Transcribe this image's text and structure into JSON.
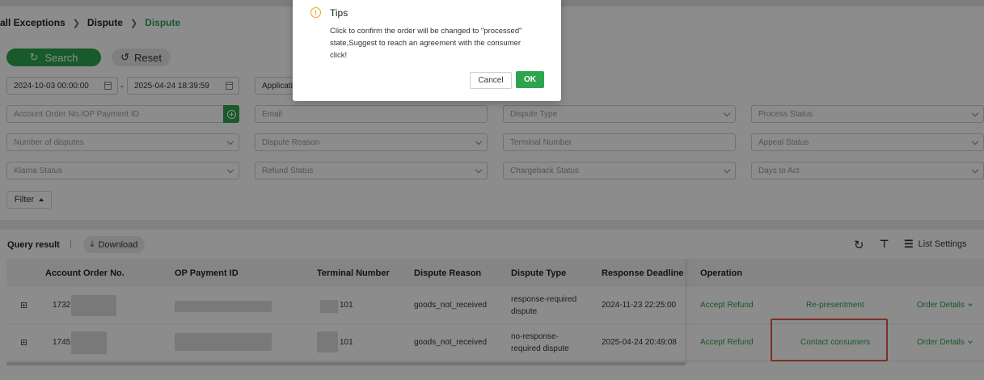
{
  "breadcrumb": [
    "all Exceptions",
    "Dispute",
    "Dispute"
  ],
  "buttons": {
    "search": "Search",
    "reset": "Reset",
    "filter": "Filter",
    "download": "Download",
    "list_settings": "List Settings"
  },
  "date_range": {
    "start": "2024-10-03 00:00:00",
    "separator": "-",
    "end": "2025-04-24 18:39:59"
  },
  "date_type_select": "Applicati",
  "fields": {
    "account_order": "Account Order No./OP Payment ID",
    "email": "Email",
    "dispute_type": "Dispute Type",
    "process_status": "Process Status",
    "number_of_disputes": "Number of disputes",
    "dispute_reason": "Dispute Reason",
    "terminal_number": "Terminal Number",
    "appeal_status": "Appeal Status",
    "klarna_status": "Klarna Status",
    "refund_status": "Refund Status",
    "chargeback_status": "Chargeback Status",
    "days_to_act": "Days to Act"
  },
  "query_result": {
    "label": "Query result",
    "separator": "|"
  },
  "table": {
    "headers": [
      "Account Order No.",
      "OP Payment ID",
      "Terminal Number",
      "Dispute Reason",
      "Dispute Type",
      "Response Deadline",
      "Operation"
    ],
    "rows": [
      {
        "order_prefix": "1732",
        "terminal_suffix": "101",
        "reason": "goods_not_received",
        "type_line1": "response-required",
        "type_line2": "dispute",
        "deadline": "2024-11-23 22:25:00",
        "op1": "Accept Refund",
        "op2": "Re-presentment",
        "op3": "Order Details"
      },
      {
        "order_prefix": "1745",
        "terminal_suffix": "101",
        "reason": "goods_not_received",
        "type_line1": "no-response-",
        "type_line2": "required dispute",
        "deadline": "2025-04-24 20:49:08",
        "op1": "Accept Refund",
        "op2": "Contact consumers",
        "op3": "Order Details"
      }
    ]
  },
  "modal": {
    "title": "Tips",
    "message_line1": "Click to confirm the order will be changed to \"processed\"",
    "message_line2": "state,Suggest to reach an agreement with the consumer",
    "message_line3": "click!",
    "cancel": "Cancel",
    "ok": "OK"
  },
  "colors": {
    "primary": "#2ea44f",
    "highlight": "#e8573c",
    "warning": "#f0a020"
  }
}
